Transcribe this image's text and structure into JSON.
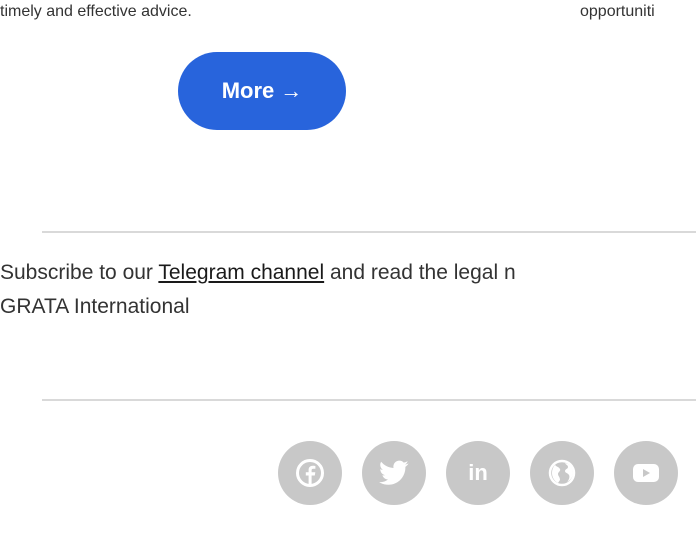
{
  "top": {
    "left_text": "timely and effective advice.",
    "right_text": "opportuniti"
  },
  "more_button": {
    "label": "More",
    "arrow": "→"
  },
  "subscribe": {
    "prefix": "Subscribe to our ",
    "link_text": "Telegram channel",
    "suffix": " and read the legal n",
    "line2": "GRATA International"
  },
  "social": {
    "icons": [
      "facebook-icon",
      "twitter-icon",
      "linkedin-icon",
      "website-globe-icon",
      "youtube-icon"
    ],
    "linkedin_glyph": "in"
  },
  "colors": {
    "accent": "#2864dc",
    "social_bg": "#c8c8c8",
    "divider": "#d9d9d9"
  }
}
